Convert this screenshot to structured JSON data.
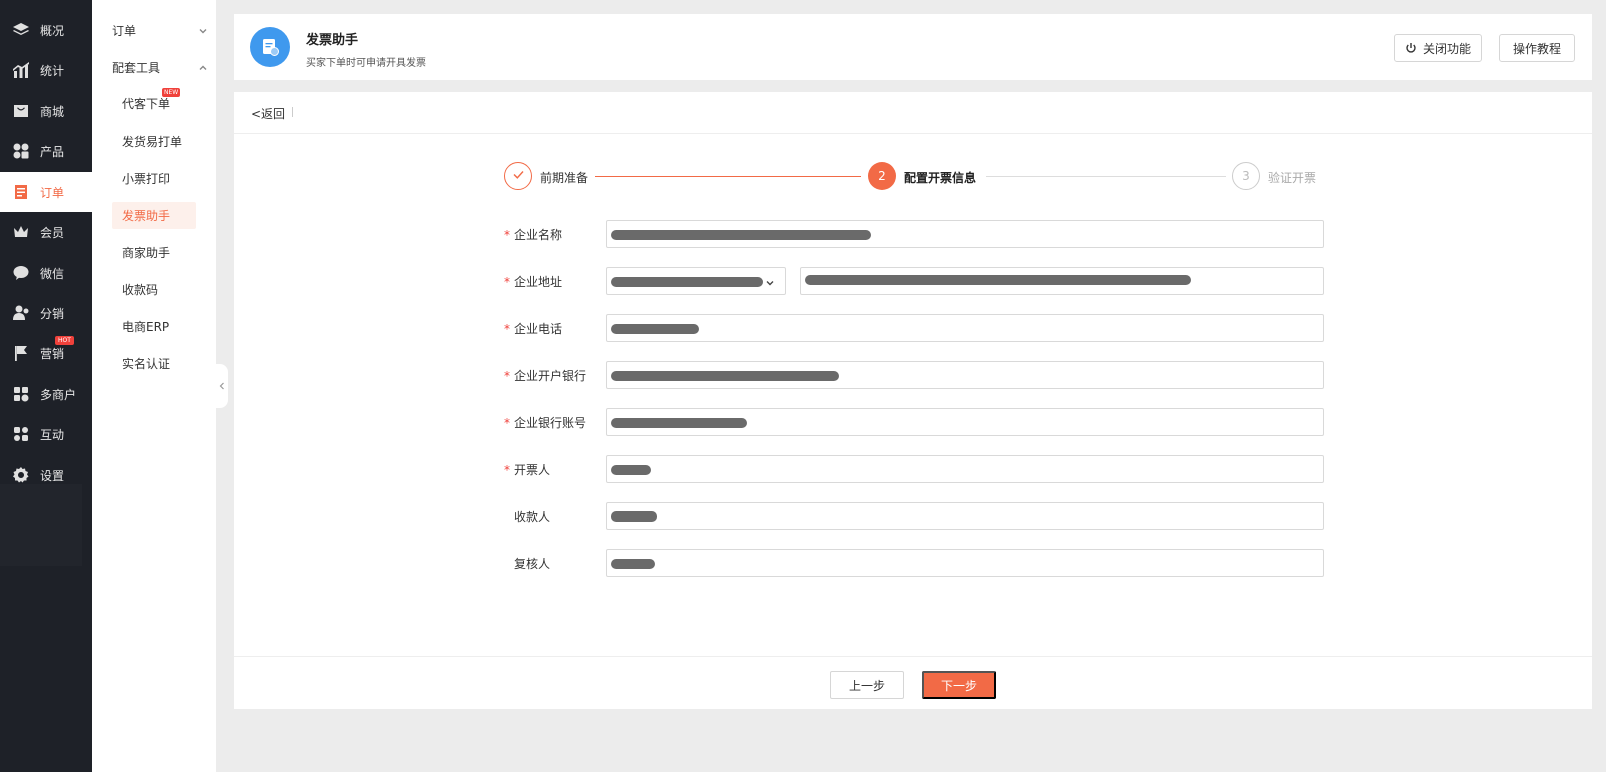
{
  "nav": {
    "items": [
      {
        "label": "概况",
        "icon": "layers-icon"
      },
      {
        "label": "统计",
        "icon": "chart-icon"
      },
      {
        "label": "商城",
        "icon": "mall-icon"
      },
      {
        "label": "产品",
        "icon": "grid-icon"
      },
      {
        "label": "订单",
        "icon": "order-icon",
        "active": true
      },
      {
        "label": "会员",
        "icon": "crown-icon"
      },
      {
        "label": "微信",
        "icon": "wechat-icon"
      },
      {
        "label": "分销",
        "icon": "distribution-icon"
      },
      {
        "label": "营销",
        "icon": "flag-icon",
        "badge": "HOT"
      },
      {
        "label": "多商户",
        "icon": "merchant-icon"
      },
      {
        "label": "互动",
        "icon": "interaction-icon"
      },
      {
        "label": "设置",
        "icon": "gear-icon"
      }
    ]
  },
  "submenu": {
    "group_order": "订单",
    "group_tools": "配套工具",
    "items": [
      {
        "label": "代客下单",
        "badge": "NEW"
      },
      {
        "label": "发货易打单"
      },
      {
        "label": "小票打印"
      },
      {
        "label": "发票助手",
        "active": true
      },
      {
        "label": "商家助手"
      },
      {
        "label": "收款码"
      },
      {
        "label": "电商ERP"
      },
      {
        "label": "实名认证"
      }
    ]
  },
  "header": {
    "title": "发票助手",
    "subtitle": "买家下单时可申请开具发票",
    "close_feature": "关闭功能",
    "tutorial": "操作教程"
  },
  "back": {
    "label": "<返回"
  },
  "steps": [
    {
      "label": "前期准备",
      "status": "done"
    },
    {
      "number": "2",
      "label": "配置开票信息",
      "status": "current"
    },
    {
      "number": "3",
      "label": "验证开票",
      "status": "pending"
    }
  ],
  "form": {
    "fields": [
      {
        "label": "企业名称",
        "required": true
      },
      {
        "label": "企业地址",
        "required": true
      },
      {
        "label": "企业电话",
        "required": true
      },
      {
        "label": "企业开户银行",
        "required": true
      },
      {
        "label": "企业银行账号",
        "required": true
      },
      {
        "label": "开票人",
        "required": true
      },
      {
        "label": "收款人",
        "required": false
      },
      {
        "label": "复核人",
        "required": false
      }
    ],
    "required_mark": "*"
  },
  "footer": {
    "prev": "上一步",
    "next": "下一步"
  },
  "colors": {
    "accent": "#f26a46",
    "nav_bg": "#1e2128",
    "logo_blue": "#3f99ee"
  }
}
